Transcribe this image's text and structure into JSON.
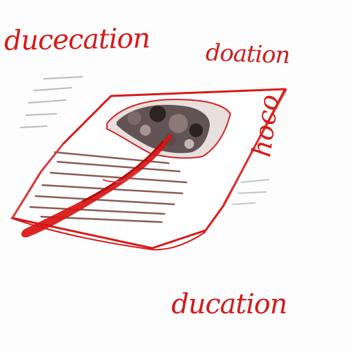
{
  "texts": {
    "title_left": "ducecation",
    "title_right": "doation",
    "side": "hoco",
    "bottom": "ducation"
  },
  "colors": {
    "ink_red": "#d81818",
    "ink_brown": "#8a5a52",
    "paper": "#ffffff",
    "photo_dark": "#3a2f2f"
  }
}
